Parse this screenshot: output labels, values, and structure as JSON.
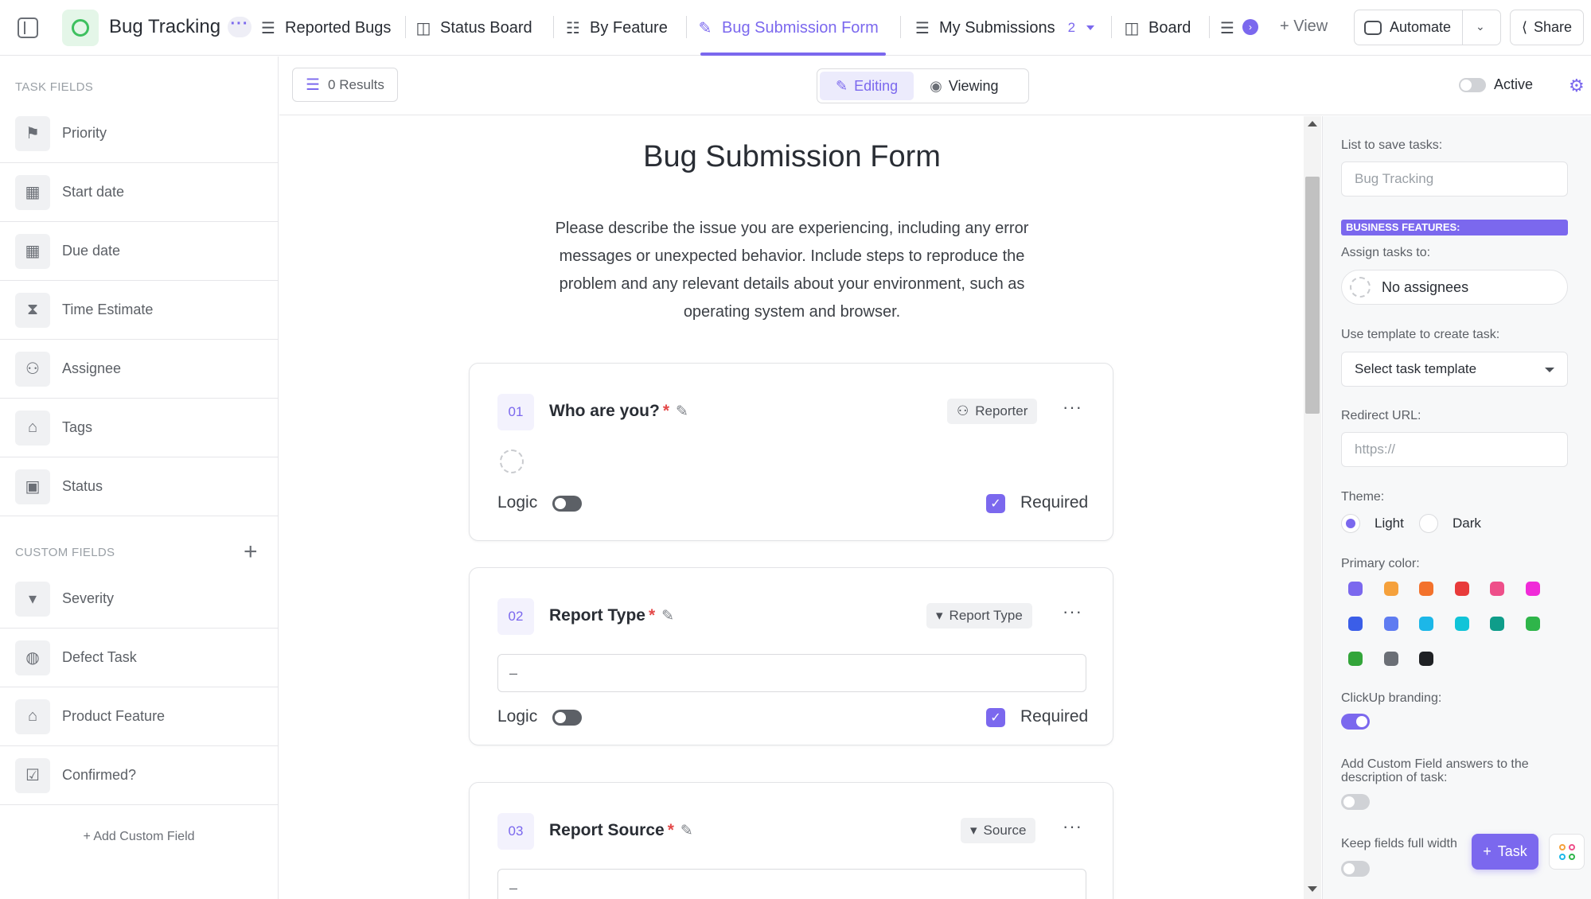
{
  "header": {
    "space_name": "Bug Tracking",
    "dots": "···",
    "tabs": [
      {
        "label": "Reported Bugs"
      },
      {
        "label": "Status Board"
      },
      {
        "label": "By Feature"
      },
      {
        "label": "Bug Submission Form"
      },
      {
        "label": "My Submissions",
        "count": "2"
      },
      {
        "label": "Board"
      }
    ],
    "add_view_label": "+ View",
    "automate_label": "Automate",
    "share_label": "Share"
  },
  "sidebar": {
    "task_fields_heading": "TASK FIELDS",
    "task_fields": [
      {
        "label": "Priority",
        "icon": "flag-icon"
      },
      {
        "label": "Start date",
        "icon": "calendar-icon"
      },
      {
        "label": "Due date",
        "icon": "calendar-icon"
      },
      {
        "label": "Time Estimate",
        "icon": "hourglass-icon"
      },
      {
        "label": "Assignee",
        "icon": "person-icon"
      },
      {
        "label": "Tags",
        "icon": "tag-icon"
      },
      {
        "label": "Status",
        "icon": "status-icon"
      }
    ],
    "custom_fields_heading": "CUSTOM FIELDS",
    "custom_fields": [
      {
        "label": "Severity",
        "icon": "dropdown-icon"
      },
      {
        "label": "Defect Task",
        "icon": "globe-icon"
      },
      {
        "label": "Product Feature",
        "icon": "tag-icon"
      },
      {
        "label": "Confirmed?",
        "icon": "checkbox-icon"
      }
    ],
    "add_custom_field_label": "+ Add Custom Field"
  },
  "toolbar": {
    "results_label": "0 Results",
    "editing_label": "Editing",
    "viewing_label": "Viewing",
    "active_label": "Active"
  },
  "form": {
    "title": "Bug Submission Form",
    "description": "Please describe the issue you are experiencing, including any error messages or unexpected behavior. Include steps to reproduce the problem and any relevant details about your environment, such as operating system and browser.",
    "questions": [
      {
        "number": "01",
        "title": "Who are you?",
        "tag": "Reporter",
        "logic_label": "Logic",
        "required_label": "Required"
      },
      {
        "number": "02",
        "title": "Report Type",
        "tag": "Report Type",
        "placeholder": "–",
        "logic_label": "Logic",
        "required_label": "Required"
      },
      {
        "number": "03",
        "title": "Report Source",
        "tag": "Source",
        "placeholder": "–"
      }
    ]
  },
  "settings_panel": {
    "list_label": "List to save tasks:",
    "list_value": "Bug Tracking",
    "business_features_label": "BUSINESS FEATURES:",
    "assign_label": "Assign tasks to:",
    "assign_value": "No assignees",
    "template_label": "Use template to create task:",
    "template_value": "Select task template",
    "redirect_label": "Redirect URL:",
    "redirect_placeholder": "https://",
    "theme_label": "Theme:",
    "theme_light": "Light",
    "theme_dark": "Dark",
    "theme_selected": "Light",
    "primary_color_label": "Primary color:",
    "primary_colors": [
      "#7b68ee",
      "#f5a13c",
      "#f3722c",
      "#e83b3b",
      "#ee4f8a",
      "#f02bd8",
      "#3b5ee8",
      "#5f7cf1",
      "#1cb7e8",
      "#11c4d8",
      "#0f9d8a",
      "#2fb54a",
      "#33a53a",
      "#6b6f76",
      "#1f2124"
    ],
    "branding_label": "ClickUp branding:",
    "branding_on": true,
    "custom_field_answers_label": "Add Custom Field answers to the description of task:",
    "custom_field_answers_on": false,
    "full_width_label": "Keep fields full width",
    "full_width_on": false
  },
  "floating": {
    "task_button_label": "Task"
  },
  "colors": {
    "accent": "#7b68ee",
    "space_green": "#3ec05f",
    "required_star": "#e44a4a"
  }
}
